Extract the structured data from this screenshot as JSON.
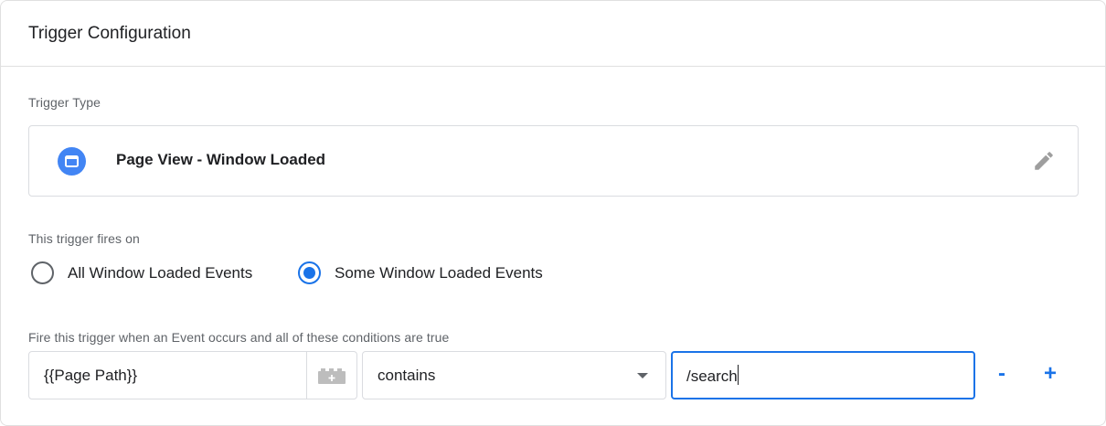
{
  "header": {
    "title": "Trigger Configuration"
  },
  "trigger_type": {
    "label": "Trigger Type",
    "name": "Page View - Window Loaded",
    "icon": "window-icon",
    "icon_color": "#4285f4"
  },
  "fires_on": {
    "label": "This trigger fires on",
    "options": [
      {
        "label": "All Window Loaded Events",
        "selected": false
      },
      {
        "label": "Some Window Loaded Events",
        "selected": true
      }
    ]
  },
  "conditions": {
    "label": "Fire this trigger when an Event occurs and all of these conditions are true",
    "variable": "{{Page Path}}",
    "operator": "contains",
    "value": "/search",
    "remove_label": "-",
    "add_label": "+"
  },
  "colors": {
    "accent": "#1a73e8",
    "border": "#dadce0",
    "muted_text": "#5f6368"
  }
}
